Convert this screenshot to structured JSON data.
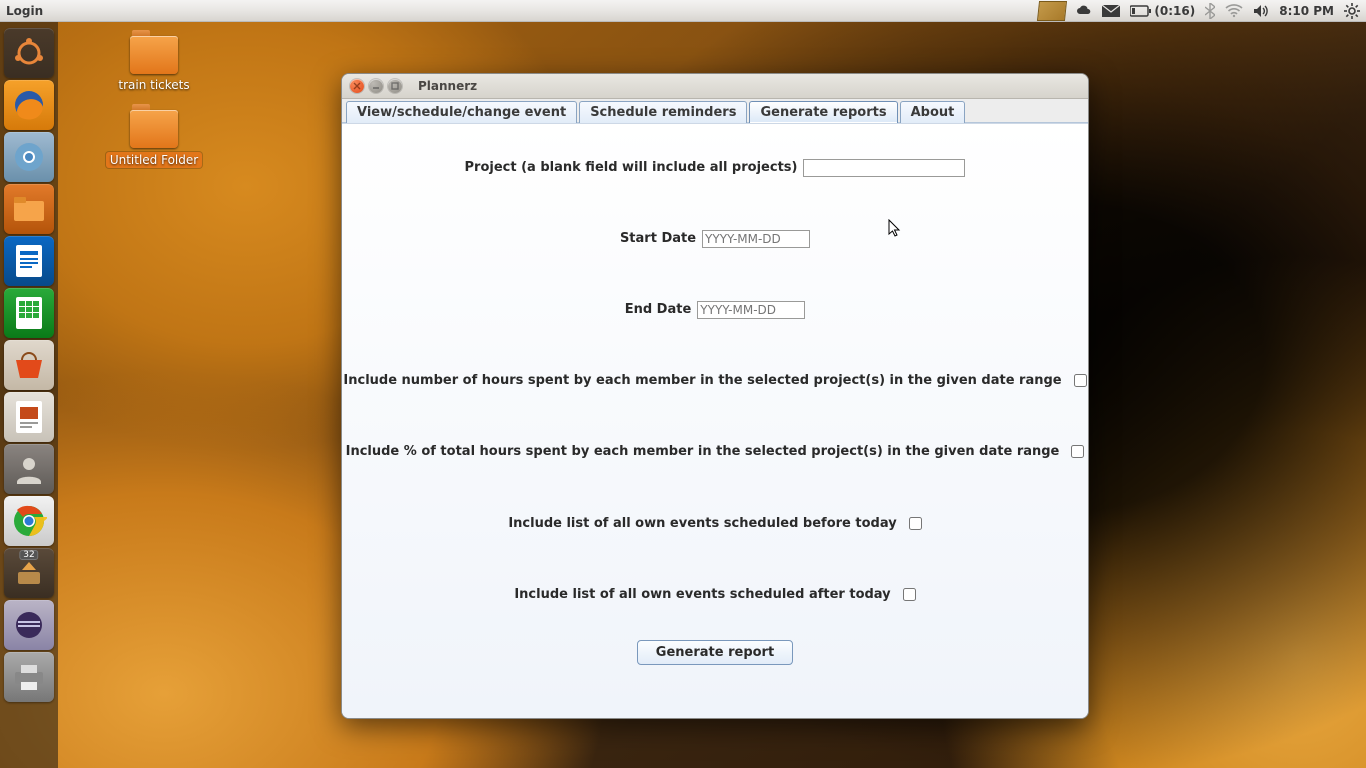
{
  "topbar": {
    "title": "Login",
    "battery": "(0:16)",
    "clock": "8:10 PM"
  },
  "desktop": {
    "icons": [
      {
        "label": "train tickets"
      },
      {
        "label": "Untitled Folder"
      }
    ]
  },
  "launcher": {
    "update_count": "32"
  },
  "window": {
    "title": "Plannerz",
    "tabs": [
      {
        "label": "View/schedule/change event"
      },
      {
        "label": "Schedule reminders"
      },
      {
        "label": "Generate reports"
      },
      {
        "label": "About"
      }
    ],
    "form": {
      "project_label": "Project (a blank field will include all projects)",
      "project_value": "",
      "start_label": "Start Date",
      "start_placeholder": "YYYY-MM-DD",
      "end_label": "End Date",
      "end_placeholder": "YYYY-MM-DD",
      "opt_hours": "Include number of hours spent by each member in the selected project(s) in the given date range",
      "opt_pct": "Include % of total hours spent by each member in the selected project(s) in the given date range",
      "opt_before": "Include list of all own events scheduled before today",
      "opt_after": "Include list of all own events scheduled after today",
      "button": "Generate report"
    }
  }
}
